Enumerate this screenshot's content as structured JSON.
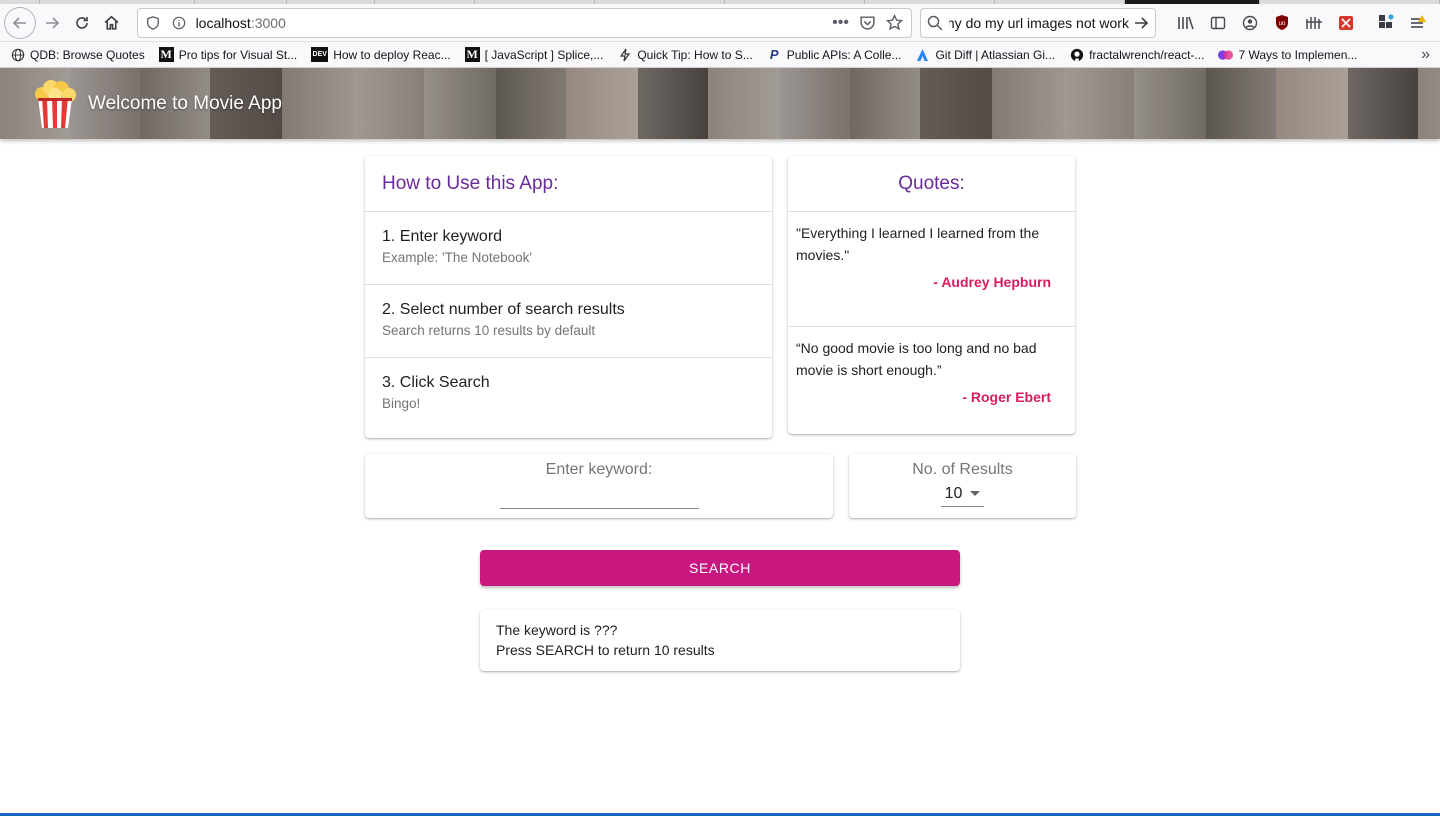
{
  "browser": {
    "url_host": "localhost",
    "url_port": ":3000",
    "search_text": "why do my url images not work",
    "bookmarks": [
      {
        "label": "QDB: Browse Quotes",
        "icon": "globe-icon"
      },
      {
        "label": "Pro tips for Visual St...",
        "icon": "medium-icon"
      },
      {
        "label": "How to deploy Reac...",
        "icon": "dev-icon"
      },
      {
        "label": "[ JavaScript ] Splice,...",
        "icon": "medium-icon"
      },
      {
        "label": "Quick Tip: How to S...",
        "icon": "bolt-icon"
      },
      {
        "label": "Public APIs: A Colle...",
        "icon": "paypal-icon"
      },
      {
        "label": "Git Diff | Atlassian Gi...",
        "icon": "atlassian-icon"
      },
      {
        "label": "fractalwrench/react-...",
        "icon": "github-icon"
      },
      {
        "label": "7 Ways to Implemen...",
        "icon": "heart-icon"
      }
    ]
  },
  "app": {
    "title": "Welcome to Movie App"
  },
  "howto": {
    "title": "How to Use this App:",
    "steps": [
      {
        "primary": "1. Enter keyword",
        "secondary": "Example: 'The Notebook'"
      },
      {
        "primary": "2. Select number of search results",
        "secondary": "Search returns 10 results by default"
      },
      {
        "primary": "3. Click Search",
        "secondary": "Bingo!"
      }
    ]
  },
  "quotes": {
    "title": "Quotes:",
    "items": [
      {
        "text": "\"Everything I learned I learned from the movies.\"",
        "author": "- Audrey Hepburn"
      },
      {
        "text": "“No good movie is too long and no bad movie is short enough.”",
        "author": "- Roger Ebert"
      }
    ]
  },
  "search": {
    "keyword_label": "Enter keyword:",
    "keyword_value": "",
    "results_label": "No. of Results",
    "results_value": "10",
    "button_label": "SEARCH"
  },
  "info": {
    "line1": "The keyword is ???",
    "line2": "Press SEARCH to return 10 results"
  },
  "colors": {
    "accent_purple": "#6a2b9a",
    "accent_pink": "#c8177f",
    "author_pink": "#d81b60"
  }
}
